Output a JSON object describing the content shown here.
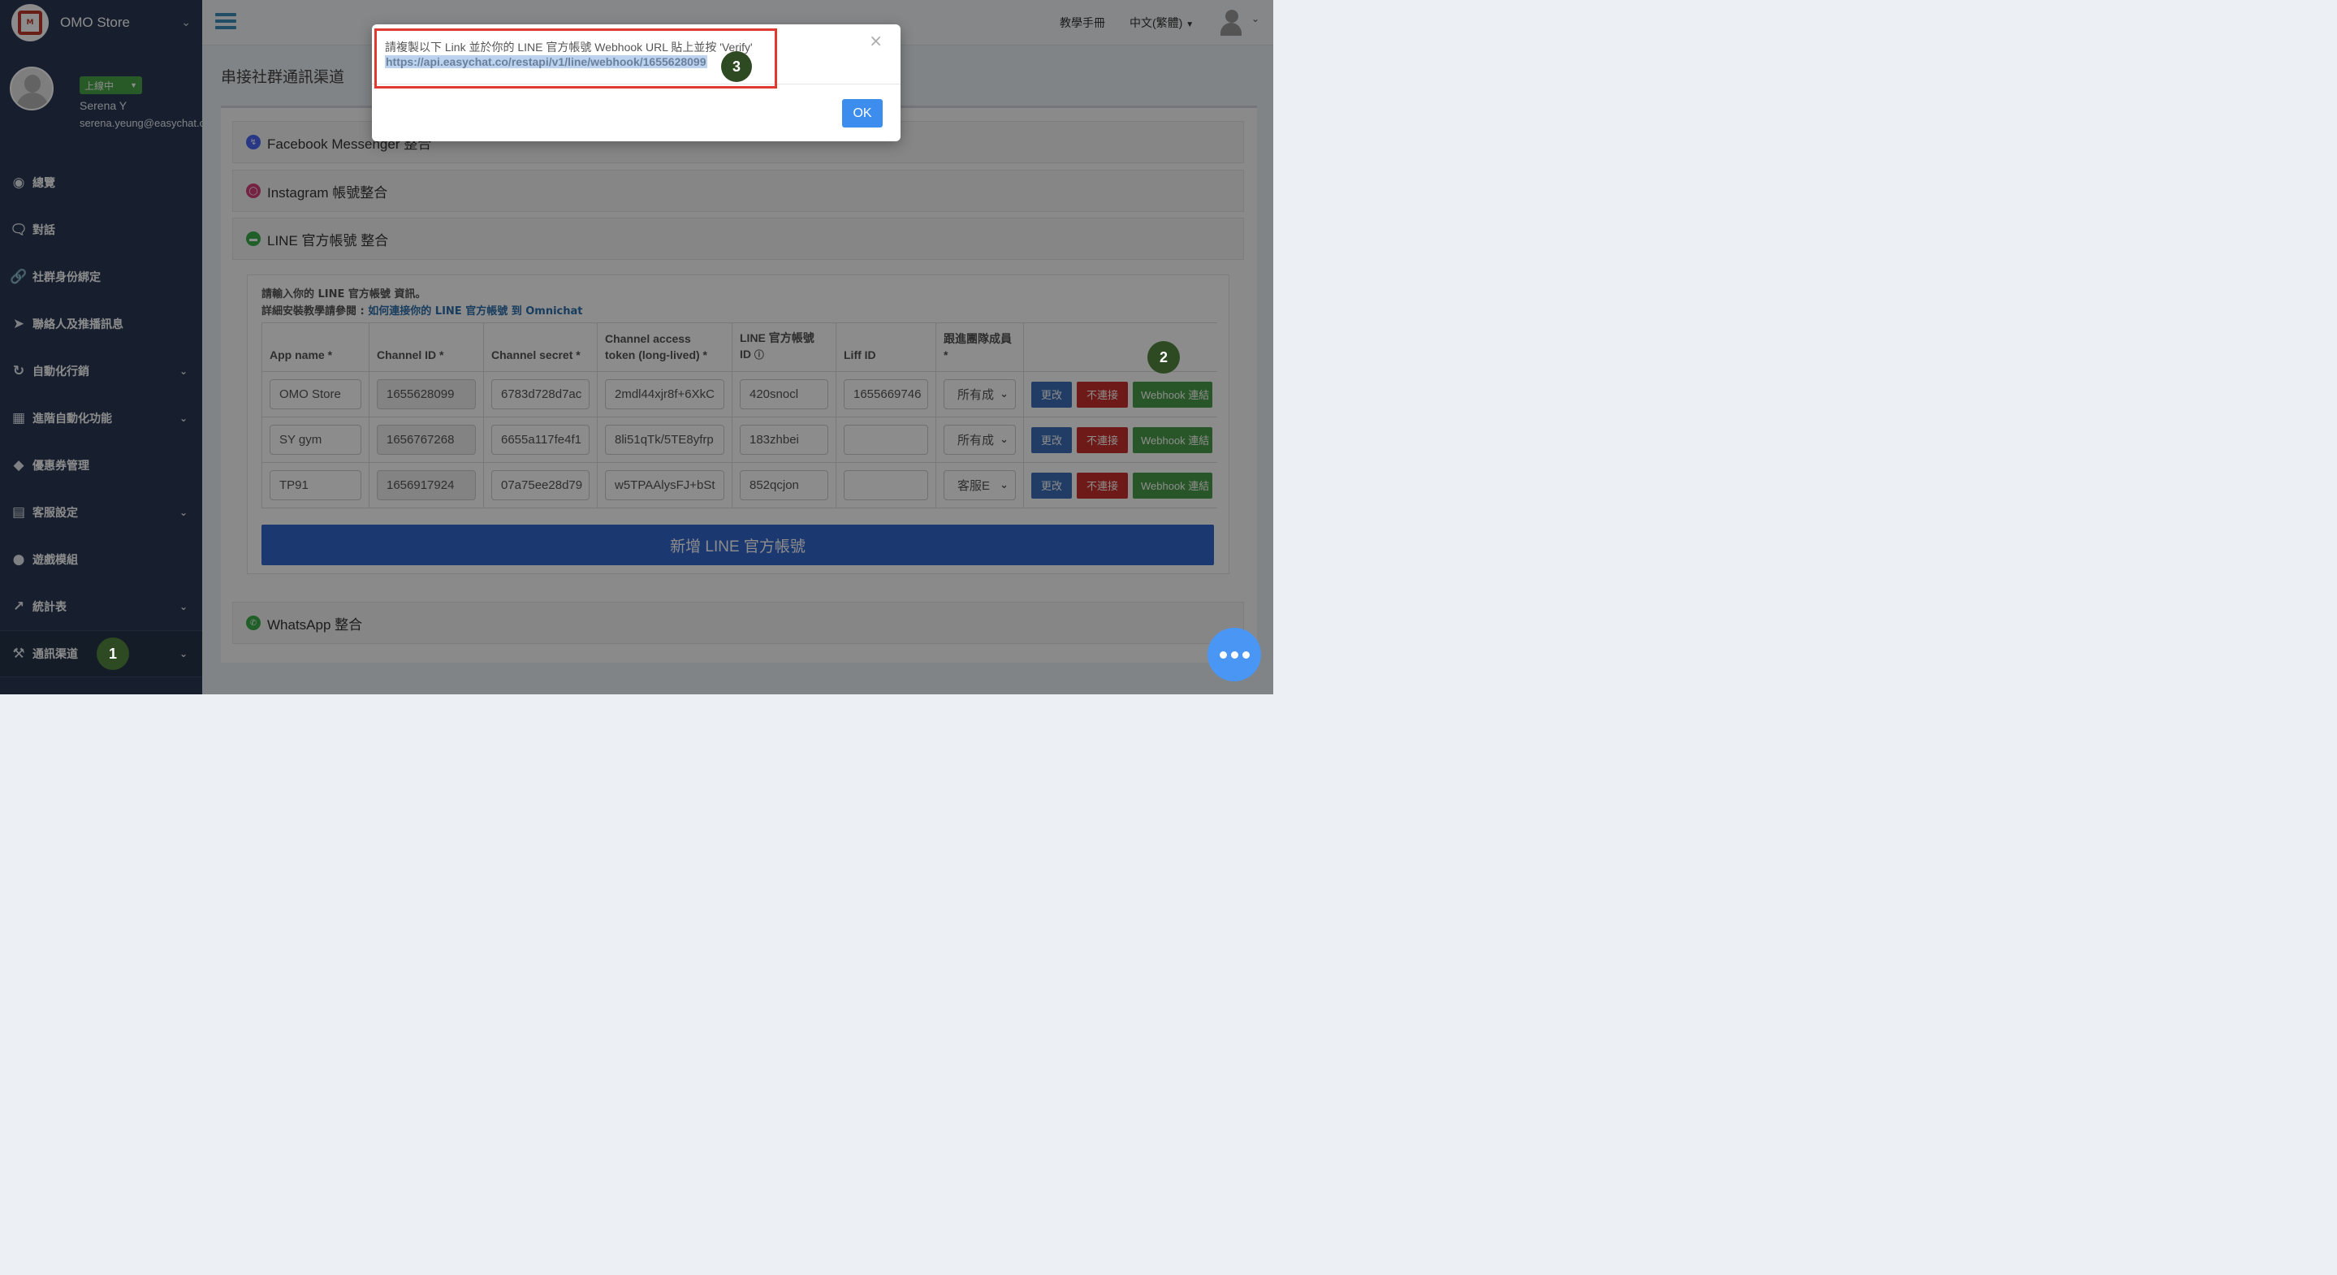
{
  "brand": {
    "name": "OMO Store",
    "logo_text": "OMO STORE"
  },
  "user": {
    "status": "上線中",
    "name": "Serena Y",
    "email": "serena.yeung@easychat.co"
  },
  "menu": [
    {
      "label": "總覽",
      "icon": "dashboard-icon",
      "has_caret": false
    },
    {
      "label": "對話",
      "icon": "chat-icon",
      "has_caret": false
    },
    {
      "label": "社群身份綁定",
      "icon": "link-icon",
      "has_caret": false
    },
    {
      "label": "聯絡人及推播訊息",
      "icon": "paper-plane-icon",
      "has_caret": false
    },
    {
      "label": "自動化行銷",
      "icon": "refresh-icon",
      "has_caret": true
    },
    {
      "label": "進階自動化功能",
      "icon": "android-icon",
      "has_caret": true
    },
    {
      "label": "優惠券管理",
      "icon": "ticket-icon",
      "has_caret": false
    },
    {
      "label": "客服設定",
      "icon": "document-icon",
      "has_caret": true
    },
    {
      "label": "遊戲模組",
      "icon": "gamepad-icon",
      "has_caret": false
    },
    {
      "label": "統計表",
      "icon": "line-chart-icon",
      "has_caret": true
    },
    {
      "label": "通訊渠道",
      "icon": "wrench-icon",
      "has_caret": true
    }
  ],
  "topbar": {
    "manual": "教學手冊",
    "language": "中文(繁體)"
  },
  "page": {
    "title": "串接社群通訊渠道"
  },
  "sections": {
    "facebook": "Facebook Messenger 整合",
    "instagram": "Instagram 帳號整合",
    "line": "LINE 官方帳號 整合",
    "whatsapp": "WhatsApp 整合"
  },
  "line_panel": {
    "desc1": "請輸入你的 LINE 官方帳號 資訊。",
    "desc2_prefix": "詳細安裝教學請參閱 : ",
    "desc2_link": "如何連接你的 LINE 官方帳號 到 Omnichat",
    "headers": [
      "App name *",
      "Channel ID *",
      "Channel secret *",
      "Channel access token (long-lived) *",
      "LINE 官方帳號 ID",
      "Liff ID",
      "跟進團隊成員 *"
    ],
    "rows": [
      {
        "app": "OMO Store",
        "channel_id": "1655628099",
        "secret": "6783d728d7ac",
        "token": "2mdl44xjr8f+6XkC",
        "line_id": "420snocl",
        "liff": "1655669746",
        "member": "所有成"
      },
      {
        "app": "SY gym",
        "channel_id": "1656767268",
        "secret": "6655a117fe4f1",
        "token": "8li51qTk/5TE8yfrp",
        "line_id": "183zhbei",
        "liff": "",
        "member": "所有成"
      },
      {
        "app": "TP91",
        "channel_id": "1656917924",
        "secret": "07a75ee28d79",
        "token": "w5TPAAlysFJ+bSt",
        "line_id": "852qcjon",
        "liff": "",
        "member": "客服E"
      }
    ],
    "btn_edit": "更改",
    "btn_disconnect": "不連接",
    "btn_webhook": "Webhook 連結",
    "add_button": "新增 LINE 官方帳號"
  },
  "modal": {
    "message": "請複製以下 Link 並於你的 LINE 官方帳號 Webhook URL 貼上並按 'Verify'",
    "url": "https://api.easychat.co/restapi/v1/line/webhook/1655628099",
    "close": "×",
    "ok": "OK"
  },
  "badges": {
    "one": "1",
    "two": "2",
    "three": "3"
  },
  "colors": {
    "sidebar": "#2a3a54",
    "accent": "#3c8dbc",
    "highlight": "#e03a2e",
    "badge": "#2e4a22"
  }
}
